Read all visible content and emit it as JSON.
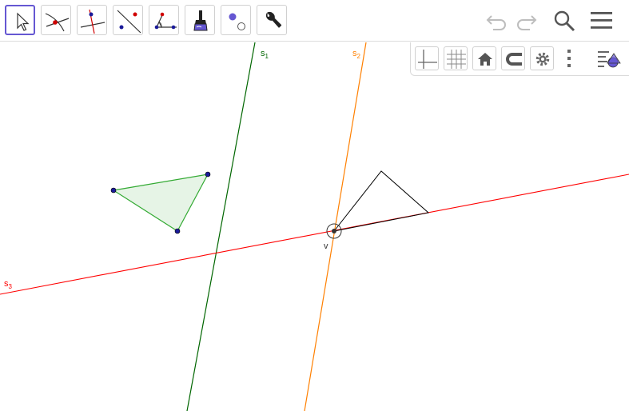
{
  "toolbar": {
    "tools": [
      {
        "name": "move-tool",
        "selected": true
      },
      {
        "name": "point-on-object-tool",
        "selected": false
      },
      {
        "name": "perpendicular-line-tool",
        "selected": false
      },
      {
        "name": "line-tool",
        "selected": false
      },
      {
        "name": "angle-tool",
        "selected": false
      },
      {
        "name": "pen-tool",
        "selected": false
      },
      {
        "name": "show-hide-object-tool",
        "selected": false
      },
      {
        "name": "tools-menu",
        "selected": false
      }
    ],
    "right": [
      "undo-icon",
      "redo-icon",
      "search-icon",
      "menu-icon"
    ]
  },
  "style_bar": {
    "buttons": [
      "axes-icon",
      "grid-icon",
      "home-icon",
      "magnet-icon",
      "gear-icon",
      "more-icon",
      "algebra-toggle-icon"
    ]
  },
  "construction": {
    "lines": [
      {
        "name": "s1",
        "label": "s",
        "sub": "1",
        "color": "#006600"
      },
      {
        "name": "s2",
        "label": "s",
        "sub": "2",
        "color": "#ff8000"
      },
      {
        "name": "s3",
        "label": "s",
        "sub": "3",
        "color": "#ff0000"
      }
    ],
    "vertex_label": "v",
    "polygon_fill": "#e6f4e6",
    "polygon_stroke": "#33aa33",
    "point_color": "#1a1a99",
    "accent": "#6557d2"
  }
}
